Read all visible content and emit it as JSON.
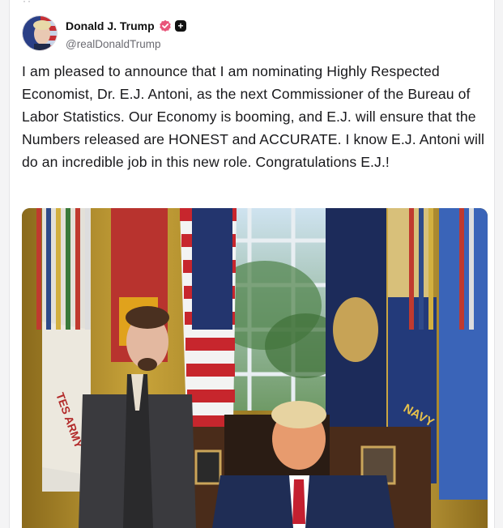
{
  "post": {
    "author_name": "Donald J. Trump",
    "handle": "@realDonaldTrump",
    "text": "I am pleased to announce that I am nominating Highly Respected Economist, Dr. E.J. Antoni, as the next Commissioner of the Bureau of Labor Statistics. Our Economy is booming, and E.J. will ensure that the Numbers released are HONEST and ACCURATE. I know E.J. Antoni will do an incredible job in this new role. Congratulations E.J.!",
    "plus_badge": "+"
  },
  "icons": {
    "verified": "verified-badge-icon",
    "plus": "plus-badge-icon"
  },
  "colors": {
    "verified_badge": "#e8557a",
    "handle_text": "#6b6b72",
    "body_text": "#18181b"
  },
  "media": {
    "flag_text_army": "TES ARMY",
    "flag_text_navy": "NAVY"
  }
}
